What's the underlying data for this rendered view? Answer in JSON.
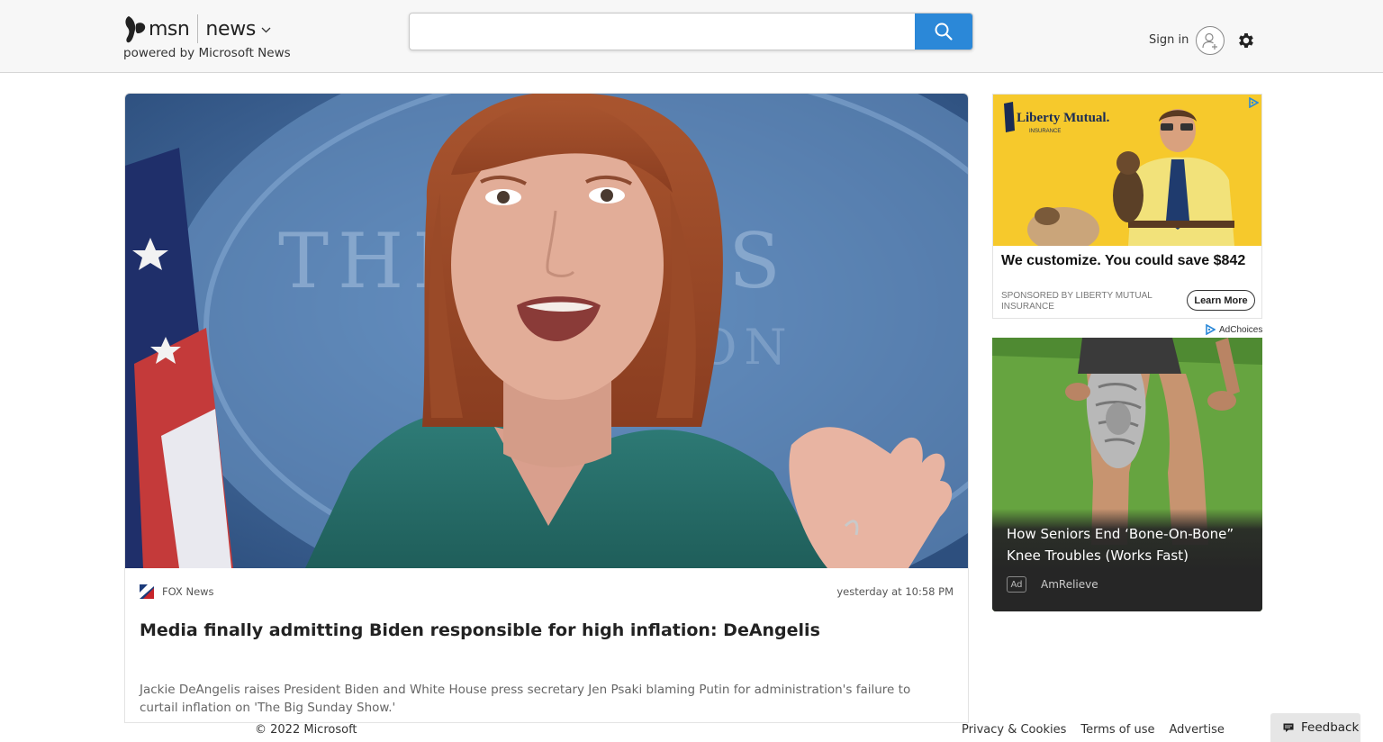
{
  "header": {
    "logo_msn": "msn",
    "logo_section": "news",
    "powered_by": "powered by Microsoft News",
    "search": {
      "value": "",
      "placeholder": ""
    },
    "sign_in": "Sign in",
    "icons": [
      "msn-butterfly-icon",
      "chevron-down-icon",
      "search-icon",
      "user-icon",
      "gear-icon"
    ]
  },
  "article": {
    "source": "FOX News",
    "timestamp": "yesterday at 10:58 PM",
    "headline": "Media finally admitting Biden responsible for high inflation: DeAngelis",
    "summary": "Jackie DeAngelis raises President Biden and White House press secretary Jen Psaki blaming Putin for administration's failure to curtail inflation on 'The Big Sunday Show.'",
    "image_backdrop_text": "THE HOUS",
    "image_backdrop_text2": "GTON"
  },
  "ads": {
    "ad1": {
      "brand_logo_text": "Liberty Mutual.",
      "brand_logo_sub": "INSURANCE",
      "title": "We customize. You could save $842",
      "sponsor": "SPONSORED BY LIBERTY MUTUAL INSURANCE",
      "cta": "Learn More"
    },
    "adchoices": "AdChoices",
    "ad2": {
      "title": "How Seniors End ‘Bone-On-Bone” Knee Troubles (Works Fast)",
      "badge": "Ad",
      "brand": "AmRelieve"
    }
  },
  "footer": {
    "copyright": "© 2022 Microsoft",
    "links": [
      "Privacy & Cookies",
      "Terms of use",
      "Advertise"
    ],
    "feedback": "Feedback"
  },
  "colors": {
    "search_button": "#2b88d8",
    "header_bg": "#f7f7f7",
    "ad1_bg": "#f6c92c",
    "ad2_bg": "#262626"
  }
}
